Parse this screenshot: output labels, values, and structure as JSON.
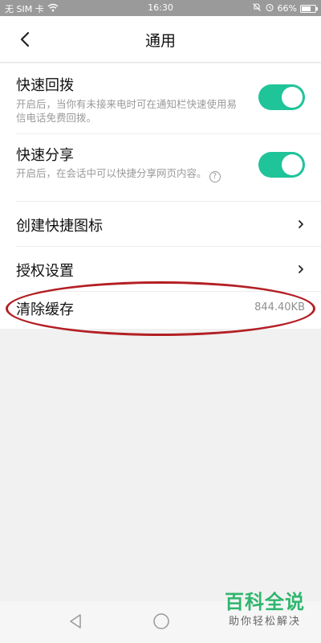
{
  "status_bar": {
    "carrier": "无 SIM 卡",
    "time": "16:30",
    "battery": "66%",
    "battery_level": 0.66,
    "icons": [
      "wifi-icon",
      "mute-bell-icon",
      "alarm-icon",
      "battery-icon"
    ]
  },
  "header": {
    "title": "通用",
    "back_icon": "chevron-left-icon"
  },
  "settings": {
    "quick_callback": {
      "title": "快速回拨",
      "description": "开启后，当你有未接来电时可在通知栏快速使用易信电话免费回拨。",
      "enabled": true
    },
    "quick_share": {
      "title": "快速分享",
      "description": "开启后，在会话中可以快捷分享网页内容。",
      "enabled": true,
      "help_icon": "question-circle-icon"
    },
    "create_shortcut": {
      "title": "创建快捷图标"
    },
    "authorization": {
      "title": "授权设置"
    },
    "clear_cache": {
      "title": "清除缓存",
      "value": "844.40KB"
    }
  },
  "nav_bar": {
    "icons": [
      "nav-back-icon",
      "nav-home-icon"
    ]
  },
  "watermark": {
    "main": "百科全说",
    "sub": "助你轻松解决"
  },
  "colors": {
    "toggle_on": "#1fc499",
    "highlight": "#b31f24",
    "status_bar": "#9a9a9a",
    "watermark_green": "#2fb66e"
  }
}
